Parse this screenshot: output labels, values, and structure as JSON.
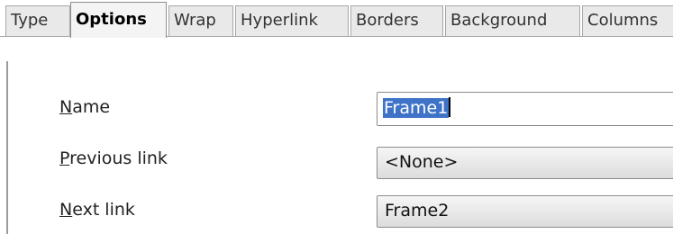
{
  "tabs": [
    {
      "label": "Type",
      "active": false
    },
    {
      "label": "Options",
      "active": true
    },
    {
      "label": "Wrap",
      "active": false
    },
    {
      "label": "Hyperlink",
      "active": false
    },
    {
      "label": "Borders",
      "active": false
    },
    {
      "label": "Background",
      "active": false
    },
    {
      "label": "Columns",
      "active": false
    }
  ],
  "fields": {
    "name": {
      "mnemonic": "N",
      "rest": "ame",
      "value": "Frame1"
    },
    "previous_link": {
      "mnemonic": "P",
      "rest": "revious link",
      "value": "<None>"
    },
    "next_link": {
      "mnemonic": "N",
      "rest": "ext link",
      "value": "Frame2"
    }
  },
  "colors": {
    "selection": "#3f73c8",
    "tab_background": "#e9e9e9",
    "active_tab_background": "#f4f4f4"
  }
}
